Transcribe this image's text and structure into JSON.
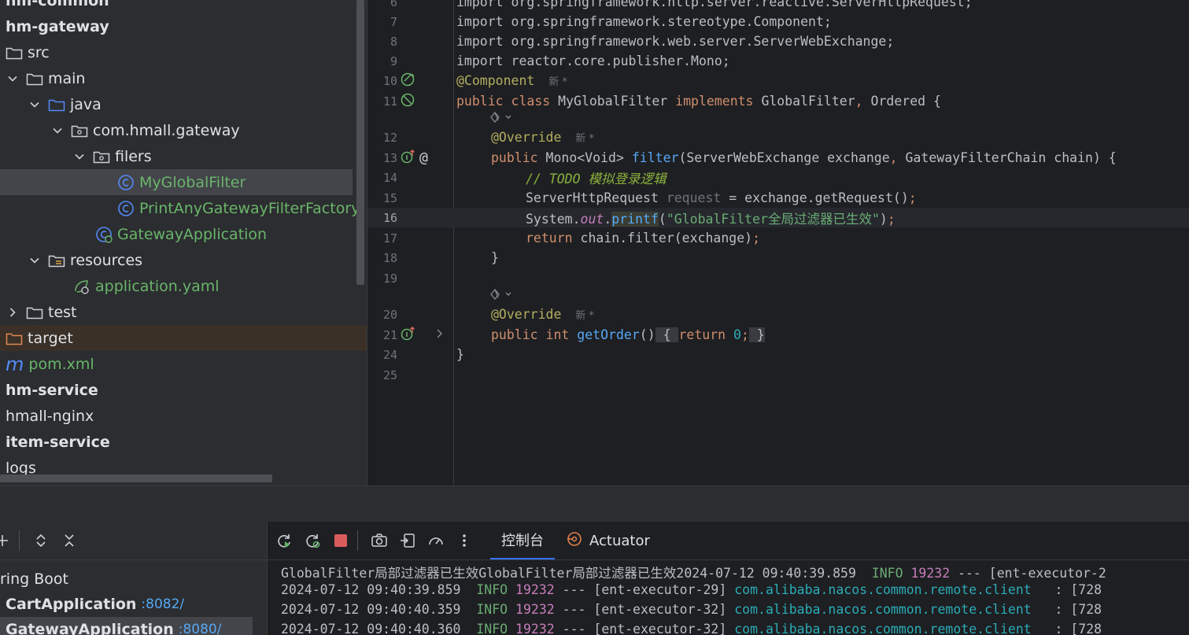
{
  "project_tree": {
    "items": [
      {
        "label": "hm-common"
      },
      {
        "label": "hm-gateway"
      },
      {
        "label": "src"
      },
      {
        "label": "main"
      },
      {
        "label": "java"
      },
      {
        "label": "com.hmall.gateway"
      },
      {
        "label": "filers"
      },
      {
        "label": "MyGlobalFilter"
      },
      {
        "label": "PrintAnyGatewayFilterFactory"
      },
      {
        "label": "GatewayApplication"
      },
      {
        "label": "resources"
      },
      {
        "label": "application.yaml"
      },
      {
        "label": "test"
      },
      {
        "label": "target"
      },
      {
        "label": "pom.xml"
      },
      {
        "label": "hm-service"
      },
      {
        "label": "hmall-nginx"
      },
      {
        "label": "item-service"
      },
      {
        "label": "logs"
      }
    ]
  },
  "editor": {
    "line_numbers": [
      "6",
      "7",
      "8",
      "9",
      "10",
      "11",
      "12",
      "13",
      "14",
      "15",
      "16",
      "17",
      "18",
      "19",
      "20",
      "21",
      "24",
      "25"
    ],
    "imports": [
      "import org.springframework.http.server.reactive.ServerHttpRequest;",
      "import org.springframework.stereotype.Component;",
      "import org.springframework.web.server.ServerWebExchange;",
      "import reactor.core.publisher.Mono;"
    ],
    "new_hint": "新 *",
    "todo_comment": "// TODO 模拟登录逻辑",
    "printf_string": "\"GlobalFilter全局过滤器已生效\""
  },
  "run": {
    "tabs": [
      {
        "label": "控制台"
      },
      {
        "label": "Actuator"
      }
    ],
    "services": [
      {
        "label": "ring Boot",
        "port": ""
      },
      {
        "label": "CartApplication",
        "port": ":8082/"
      },
      {
        "label": "GatewayApplication",
        "port": ":8080/"
      }
    ],
    "console_lines": [
      {
        "prefix": "GlobalFilter局部过滤器已生效GlobalFilter局部过滤器已生效2024-07-12 09:40:39.859  ",
        "level": "INFO",
        "pid": "19232",
        "thread": " --- [ent-executor-2",
        "cls": "",
        "rest": ""
      },
      {
        "prefix": "2024-07-12 09:40:39.859  ",
        "level": "INFO",
        "pid": "19232",
        "thread": " --- [ent-executor-29] ",
        "cls": "com.alibaba.nacos.common.remote.client",
        "rest": "   : [728"
      },
      {
        "prefix": "2024-07-12 09:40:40.359  ",
        "level": "INFO",
        "pid": "19232",
        "thread": " --- [ent-executor-32] ",
        "cls": "com.alibaba.nacos.common.remote.client",
        "rest": "   : [728"
      },
      {
        "prefix": "2024-07-12 09:40:40.360  ",
        "level": "INFO",
        "pid": "19232",
        "thread": " --- [ent-executor-32] ",
        "cls": "com.alibaba.nacos.common.remote.client",
        "rest": "   : [728"
      }
    ]
  },
  "colors": {
    "accent": "#3574f0",
    "class_icon": "#548af7",
    "string": "#6aab73",
    "keyword": "#cf8e6d"
  }
}
